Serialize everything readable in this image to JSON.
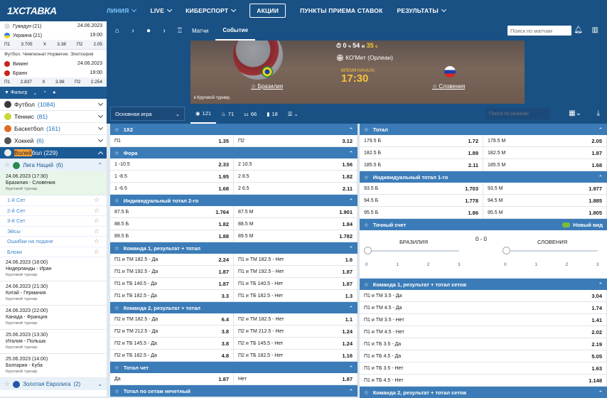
{
  "header": {
    "logo": "1XСТАВКА",
    "nav": [
      {
        "label": "ЛИНИЯ",
        "active": true,
        "chev": true
      },
      {
        "label": "LIVE",
        "chev": true
      },
      {
        "label": "КИБЕРСПОРТ",
        "chev": true
      },
      {
        "label": "АКЦИИ",
        "boxed": true
      },
      {
        "label": "ПУНКТЫ ПРИЕМА СТАВОК"
      },
      {
        "label": "РЕЗУЛЬТАТЫ",
        "chev": true
      }
    ]
  },
  "sidebar": {
    "mini1": {
      "team1": "Гуандун (21)",
      "date1": "24.06.2023",
      "team2": "Украина (21)",
      "time": "19:00",
      "odds": [
        "П1",
        "3.705",
        "X",
        "3.38",
        "П2",
        "2.05"
      ]
    },
    "mini2": {
      "title": "Футбол. Чемпионат Норвегии. Элитсерия",
      "team1": "Викинг",
      "date": "24.06.2023",
      "team2": "Бранн",
      "time": "19:00",
      "odds": [
        "П1",
        "2.837",
        "X",
        "3.98",
        "П2",
        "2.254"
      ]
    },
    "filter_label": "Фильтр",
    "sports": [
      {
        "name": "Футбол",
        "count": "(1084)",
        "color": "#3a3a3a"
      },
      {
        "name": "Теннис",
        "count": "(81)",
        "color": "#c9d93a"
      },
      {
        "name": "Баскетбол",
        "count": "(161)",
        "color": "#e06b22"
      },
      {
        "name": "Хоккей",
        "count": "(6)",
        "color": "#555"
      }
    ],
    "volley": {
      "hl": "Волей",
      "rest": "бол",
      "count": "(229)"
    },
    "league": "Лига Наций",
    "league_count": "(6)",
    "selected_event": {
      "date": "24.06.2023 (17:30)",
      "teams": "Бразилия - Словения",
      "sub": "Круговой турнир."
    },
    "subbets": [
      "1-й Сет",
      "2-й Сет",
      "3-й Сет",
      "Эйсы",
      "Ошибки на подаче",
      "Блоки"
    ],
    "events": [
      {
        "date": "24.06.2023 (18:00)",
        "teams": "Нидерланды - Иран",
        "sub": "Круговой турнир."
      },
      {
        "date": "24.06.2023 (21:30)",
        "teams": "Китай - Германия",
        "sub": "Круговой турнир."
      },
      {
        "date": "24.06.2023 (22:00)",
        "teams": "Канада - Франция",
        "sub": "Круговой турнир."
      },
      {
        "date": "25.06.2023 (13:30)",
        "teams": "Италия - Польша",
        "sub": "Круговой турнир."
      },
      {
        "date": "25.06.2023 (14:00)",
        "teams": "Болгария - Куба",
        "sub": "Круговой турнир."
      }
    ],
    "bottom_league": "Золотая Евролига",
    "bottom_count": "(2)"
  },
  "subnav": {
    "tabs": [
      "Матчи",
      "Событие"
    ],
    "search_placeholder": "Поиск по матчам"
  },
  "hero": {
    "timer_prefix": "0",
    "timer_h": "ч",
    "timer_m": "54",
    "timer_mu": "м",
    "timer_s": "35",
    "timer_su": "с",
    "venue": "КО'Мет (Орлеан)",
    "start_label": "ВРЕМЯ НАЧАЛА",
    "start_time": "17:30",
    "team1": "Бразилия",
    "team2": "Словения",
    "tournament": "Круговой турнир."
  },
  "filters": {
    "group": "Основная игра",
    "chips": [
      "121",
      "71",
      "66",
      "18"
    ],
    "search_placeholder": "Поиск по рынкам"
  },
  "left_markets": [
    {
      "title": "1X2",
      "rows": [
        [
          [
            "П1",
            "1.35"
          ],
          [
            "П2",
            "3.12"
          ]
        ]
      ]
    },
    {
      "title": "Фора",
      "rows": [
        [
          [
            "1 -10.5",
            "2.33"
          ],
          [
            "2 10.5",
            "1.56"
          ]
        ],
        [
          [
            "1 -8.5",
            "1.95"
          ],
          [
            "2 8.5",
            "1.82"
          ]
        ],
        [
          [
            "1 -6.5",
            "1.68"
          ],
          [
            "2 6.5",
            "2.11"
          ]
        ]
      ]
    },
    {
      "title": "Индивидуальный тотал 2-го",
      "rows": [
        [
          [
            "87.5 Б",
            "1.764"
          ],
          [
            "87.5 М",
            "1.901"
          ]
        ],
        [
          [
            "88.5 Б",
            "1.82"
          ],
          [
            "88.5 М",
            "1.84"
          ]
        ],
        [
          [
            "89.5 Б",
            "1.88"
          ],
          [
            "89.5 М",
            "1.782"
          ]
        ]
      ]
    },
    {
      "title": "Команда 1, результат + тотал",
      "rows": [
        [
          [
            "П1 и ТМ 182.5 - Да",
            "2.24"
          ],
          [
            "П1 и ТМ 182.5 - Нет",
            "1.6"
          ]
        ],
        [
          [
            "П1 и ТМ 192.5 - Да",
            "1.87"
          ],
          [
            "П1 и ТМ 192.5 - Нет",
            "1.87"
          ]
        ],
        [
          [
            "П1 и ТБ 140.5 - Да",
            "1.87"
          ],
          [
            "П1 и ТБ 140.5 - Нет",
            "1.87"
          ]
        ],
        [
          [
            "П1 и ТБ 182.5 - Да",
            "3.3"
          ],
          [
            "П1 и ТБ 182.5 - Нет",
            "1.3"
          ]
        ]
      ]
    },
    {
      "title": "Команда 2, результат + тотал",
      "rows": [
        [
          [
            "П2 и ТМ 182.5 - Да",
            "6.4"
          ],
          [
            "П2 и ТМ 182.5 - Нет",
            "1.1"
          ]
        ],
        [
          [
            "П2 и ТМ 212.5 - Да",
            "3.8"
          ],
          [
            "П2 и ТМ 212.5 - Нет",
            "1.24"
          ]
        ],
        [
          [
            "П2 и ТБ 145.5 - Да",
            "3.8"
          ],
          [
            "П2 и ТБ 145.5 - Нет",
            "1.24"
          ]
        ],
        [
          [
            "П2 и ТБ 182.5 - Да",
            "4.8"
          ],
          [
            "П2 и ТБ 182.5 - Нет",
            "1.16"
          ]
        ]
      ]
    },
    {
      "title": "Тотал чет",
      "rows": [
        [
          [
            "Да",
            "1.87"
          ],
          [
            "Нет",
            "1.87"
          ]
        ]
      ]
    },
    {
      "title": "Тотал по сетам нечетный",
      "rows": []
    }
  ],
  "right_markets": [
    {
      "title": "Тотал",
      "rows": [
        [
          [
            "179.5 Б",
            "1.72"
          ],
          [
            "179.5 М",
            "2.05"
          ]
        ],
        [
          [
            "182.5 Б",
            "1.89"
          ],
          [
            "182.5 М",
            "1.87"
          ]
        ],
        [
          [
            "185.5 Б",
            "2.11"
          ],
          [
            "185.5 М",
            "1.68"
          ]
        ]
      ]
    },
    {
      "title": "Индивидуальный тотал 1-го",
      "rows": [
        [
          [
            "93.5 Б",
            "1.703"
          ],
          [
            "93.5 М",
            "1.977"
          ]
        ],
        [
          [
            "94.5 Б",
            "1.778"
          ],
          [
            "94.5 М",
            "1.885"
          ]
        ],
        [
          [
            "95.5 Б",
            "1.86"
          ],
          [
            "95.5 М",
            "1.805"
          ]
        ]
      ]
    }
  ],
  "score": {
    "title": "Точный счет",
    "new_view": "Новый вид",
    "team1": "БРАЗИЛИЯ",
    "team2": "СЛОВЕНИЯ",
    "score": "0 - 0",
    "ticks": [
      "0",
      "1",
      "2",
      "3"
    ]
  },
  "right_single": {
    "title": "Команда 1, результат + тотал сетов",
    "rows": [
      [
        "П1 и ТМ 3.5 - Да",
        "3.04"
      ],
      [
        "П1 и ТМ 4.5 - Да",
        "1.74"
      ],
      [
        "П1 и ТМ 3.5 - Нет",
        "1.41"
      ],
      [
        "П1 и ТМ 4.5 - Нет",
        "2.02"
      ],
      [
        "П1 и ТБ 3.5 - Да",
        "2.19"
      ],
      [
        "П1 и ТБ 4.5 - Да",
        "5.05"
      ],
      [
        "П1 и ТБ 3.5 - Нет",
        "1.63"
      ],
      [
        "П1 и ТБ 4.5 - Нет",
        "1.148"
      ]
    ]
  },
  "right_bottom": "Команда 2, результат + тотал сетов"
}
